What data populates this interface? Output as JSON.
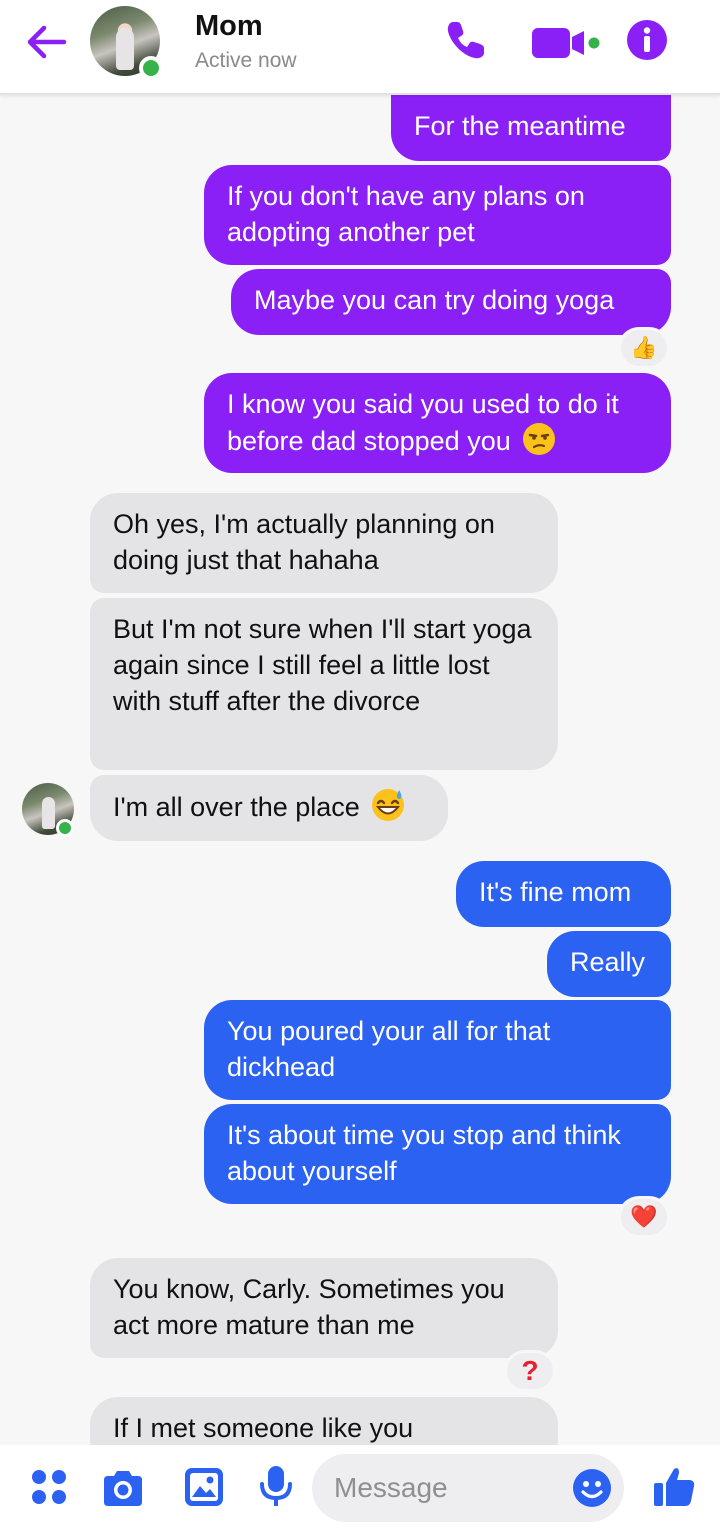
{
  "header": {
    "contact_name": "Mom",
    "status": "Active now",
    "icons": [
      "back-arrow-icon",
      "phone-icon",
      "video-icon",
      "info-icon"
    ]
  },
  "colors": {
    "accent": "#8a20f5",
    "outgoing_purple": "#8a20f5",
    "outgoing_blue": "#2c62f2",
    "incoming": "#e4e4e6",
    "online": "#36b24a"
  },
  "messages": [
    {
      "from": "me",
      "text": "For the meantime"
    },
    {
      "from": "me",
      "text": "If you don't have any plans on adopting another pet"
    },
    {
      "from": "me",
      "text": "Maybe you can try doing yoga",
      "reaction": "👍"
    },
    {
      "from": "me",
      "text": "I know you said you used to do it before dad stopped you",
      "emoji": "unamused-face"
    },
    {
      "from": "them",
      "text": "Oh yes, I'm actually planning on doing just that hahaha"
    },
    {
      "from": "them",
      "text": "But I'm not sure when I'll start yoga again since I still feel a little lost with stuff after the divorce"
    },
    {
      "from": "them",
      "text": "I'm all over the place",
      "emoji": "grinning-sweat-face"
    },
    {
      "from": "me",
      "text": "It's fine mom"
    },
    {
      "from": "me",
      "text": "Really"
    },
    {
      "from": "me",
      "text": "You poured your all for that dickhead"
    },
    {
      "from": "me",
      "text": "It's about time you stop and think about yourself",
      "reaction": "❤️"
    },
    {
      "from": "them",
      "text": "You know, Carly. Sometimes you act more mature than me",
      "reaction": "?"
    },
    {
      "from": "them",
      "text": "If I met someone like you"
    }
  ],
  "composer": {
    "placeholder": "Message",
    "icons": [
      "apps-icon",
      "camera-icon",
      "gallery-icon",
      "microphone-icon",
      "emoji-icon",
      "thumbs-up-icon"
    ]
  }
}
